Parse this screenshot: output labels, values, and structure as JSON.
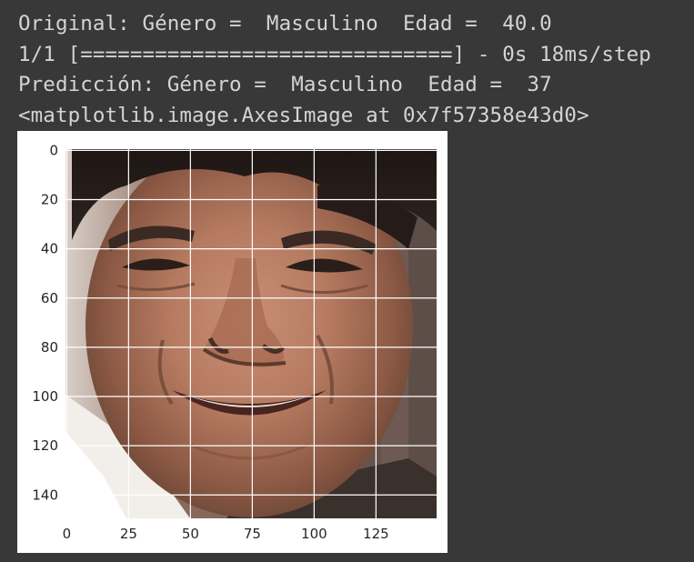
{
  "console": {
    "original_line": "Original: Género =  Masculino  Edad =  40.0",
    "progress_line": "1/1 [==============================] - 0s 18ms/step",
    "prediction_line": "Predicción: Género =  Masculino  Edad =  37",
    "repr_line": "<matplotlib.image.AxesImage at 0x7f57358e43d0>"
  },
  "figure": {
    "image_subject": "portrait photograph of a smiling man",
    "grid": true,
    "colors": {
      "background": "#383838",
      "text": "#d4d4d4",
      "grid": "#ffffff",
      "axes_background": "#ffffff"
    }
  },
  "chart_data": {
    "type": "image",
    "x_ticks": [
      "0",
      "25",
      "50",
      "75",
      "100",
      "125"
    ],
    "y_ticks": [
      "0",
      "20",
      "40",
      "60",
      "80",
      "100",
      "120",
      "140"
    ],
    "x_tick_values": [
      0,
      25,
      50,
      75,
      100,
      125
    ],
    "y_tick_values": [
      0,
      20,
      40,
      60,
      80,
      100,
      120,
      140
    ],
    "xlim": [
      -0.5,
      149.5
    ],
    "ylim": [
      149.5,
      -0.5
    ],
    "grid": true
  }
}
